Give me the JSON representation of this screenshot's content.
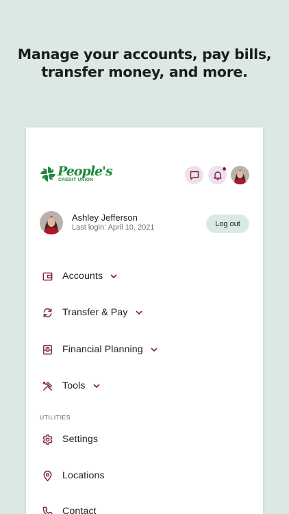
{
  "headline": {
    "line1": "Manage your accounts, pay bills,",
    "line2": "transfer money, and more."
  },
  "header": {
    "logo_text": "People's",
    "logo_subtext": "CREDIT UNION",
    "icons": [
      "message-icon",
      "bell-icon",
      "avatar"
    ]
  },
  "profile": {
    "name": "Ashley Jefferson",
    "last_login": "Last login: April 10, 2021",
    "logout_label": "Log out"
  },
  "menu": {
    "items": [
      {
        "label": "Accounts",
        "icon": "wallet-icon",
        "expandable": true
      },
      {
        "label": "Transfer & Pay",
        "icon": "transfer-icon",
        "expandable": true
      },
      {
        "label": "Financial Planning",
        "icon": "planning-icon",
        "expandable": true
      },
      {
        "label": "Tools",
        "icon": "tools-icon",
        "expandable": true
      }
    ],
    "utilities_label": "UTILITIES",
    "utilities": [
      {
        "label": "Settings",
        "icon": "gear-icon"
      },
      {
        "label": "Locations",
        "icon": "location-pin-icon"
      },
      {
        "label": "Contact",
        "icon": "phone-icon"
      }
    ]
  },
  "colors": {
    "background": "#dce9e3",
    "accent": "#7a1a4e",
    "brand_green": "#1f8a3b",
    "icon_bubble": "#ede2ea",
    "logout_bg": "#dbe9e3"
  }
}
